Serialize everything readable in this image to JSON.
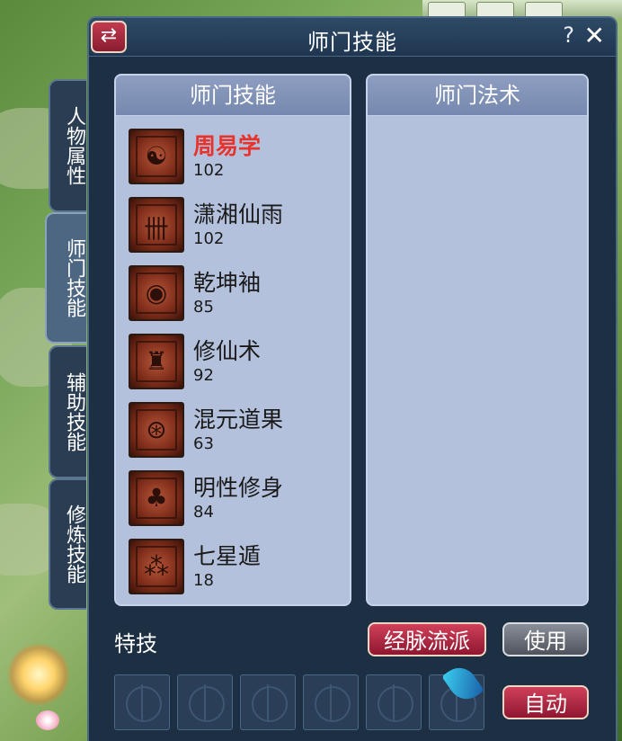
{
  "window": {
    "title": "师门技能"
  },
  "side_tabs": [
    {
      "label": "人物属性",
      "active": false
    },
    {
      "label": "师门技能",
      "active": true
    },
    {
      "label": "辅助技能",
      "active": false
    },
    {
      "label": "修炼技能",
      "active": false
    }
  ],
  "left_panel": {
    "header": "师门技能",
    "skills": [
      {
        "name": "周易学",
        "level": "102",
        "icon": "taiji-icon"
      },
      {
        "name": "潇湘仙雨",
        "level": "102",
        "icon": "rain-icon"
      },
      {
        "name": "乾坤袖",
        "level": "85",
        "icon": "sleeve-icon"
      },
      {
        "name": "修仙术",
        "level": "92",
        "icon": "turtle-icon"
      },
      {
        "name": "混元道果",
        "level": "63",
        "icon": "orb-icon"
      },
      {
        "name": "明性修身",
        "level": "84",
        "icon": "tree-icon"
      },
      {
        "name": "七星遁",
        "level": "18",
        "icon": "star-icon"
      }
    ]
  },
  "right_panel": {
    "header": "师门法术"
  },
  "bottom": {
    "special_label": "特技",
    "meridian_button": "经脉流派",
    "use_button": "使用",
    "auto_button": "自动"
  },
  "colors": {
    "selected_skill": "#e8332c",
    "panel_bg": "#b4c1dc",
    "window_bg": "#1d2f43"
  }
}
